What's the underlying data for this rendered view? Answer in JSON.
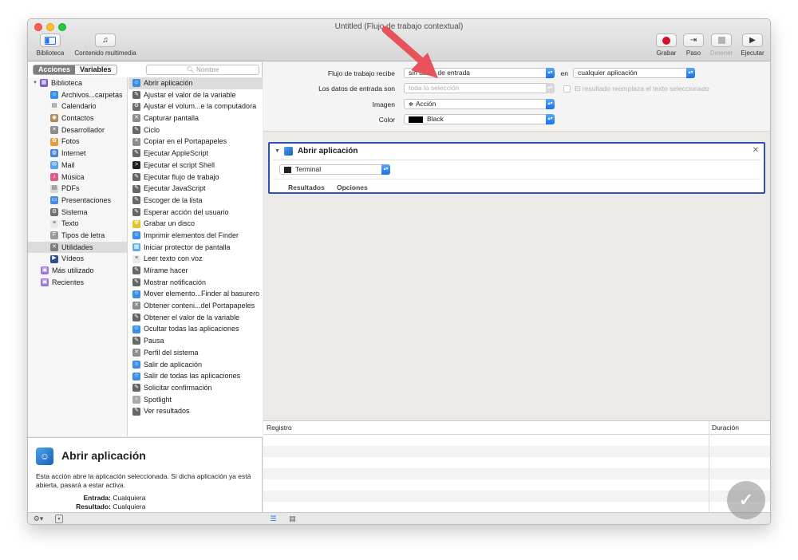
{
  "window": {
    "title": "Untitled (Flujo de trabajo contextual)"
  },
  "toolbar": {
    "left": [
      {
        "label": "Biblioteca",
        "icon": "library-icon"
      },
      {
        "label": "Contenido multimedia",
        "icon": "music-icon"
      }
    ],
    "right": [
      {
        "label": "Grabar",
        "icon": "record-icon",
        "enabled": true
      },
      {
        "label": "Paso",
        "icon": "step-icon",
        "enabled": true
      },
      {
        "label": "Detener",
        "icon": "stop-icon",
        "enabled": false
      },
      {
        "label": "Ejecutar",
        "icon": "play-icon",
        "enabled": true
      }
    ]
  },
  "sidebar": {
    "tabs": [
      "Acciones",
      "Variables"
    ],
    "active_tab": "Acciones",
    "search_placeholder": "Nombre",
    "library": [
      {
        "label": "Biblioteca",
        "level": 0,
        "icon": "library-icon"
      },
      {
        "label": "Archivos...carpetas",
        "level": 1,
        "icon": "finder-icon"
      },
      {
        "label": "Calendario",
        "level": 1,
        "icon": "calendar-icon"
      },
      {
        "label": "Contactos",
        "level": 1,
        "icon": "contacts-icon"
      },
      {
        "label": "Desarrollador",
        "level": 1,
        "icon": "tools-icon"
      },
      {
        "label": "Fotos",
        "level": 1,
        "icon": "photos-icon"
      },
      {
        "label": "Internet",
        "level": 1,
        "icon": "globe-icon"
      },
      {
        "label": "Mail",
        "level": 1,
        "icon": "mail-icon"
      },
      {
        "label": "Música",
        "level": 1,
        "icon": "music-icon"
      },
      {
        "label": "PDFs",
        "level": 1,
        "icon": "pdf-icon"
      },
      {
        "label": "Presentaciones",
        "level": 1,
        "icon": "presentation-icon"
      },
      {
        "label": "Sistema",
        "level": 1,
        "icon": "system-icon"
      },
      {
        "label": "Texto",
        "level": 1,
        "icon": "text-icon"
      },
      {
        "label": "Tipos de letra",
        "level": 1,
        "icon": "font-icon"
      },
      {
        "label": "Utilidades",
        "level": 1,
        "icon": "utilities-icon",
        "selected": true
      },
      {
        "label": "Vídeos",
        "level": 1,
        "icon": "video-icon"
      },
      {
        "label": "Más utilizado",
        "level": 0,
        "icon": "smart-folder-icon"
      },
      {
        "label": "Recientes",
        "level": 0,
        "icon": "smart-folder-icon"
      }
    ],
    "actions": [
      {
        "label": "Abrir aplicación",
        "icon": "finder-icon",
        "selected": true
      },
      {
        "label": "Ajustar el valor de la variable",
        "icon": "automator-icon"
      },
      {
        "label": "Ajustar el volum...e la computadora",
        "icon": "system-icon"
      },
      {
        "label": "Capturar pantalla",
        "icon": "tools-icon"
      },
      {
        "label": "Ciclo",
        "icon": "automator-icon"
      },
      {
        "label": "Copiar en el Portapapeles",
        "icon": "tools-icon"
      },
      {
        "label": "Ejecutar AppleScript",
        "icon": "automator-icon"
      },
      {
        "label": "Ejecutar el script Shell",
        "icon": "terminal-icon"
      },
      {
        "label": "Ejecutar flujo de trabajo",
        "icon": "automator-icon"
      },
      {
        "label": "Ejecutar JavaScript",
        "icon": "automator-icon"
      },
      {
        "label": "Escoger de la lista",
        "icon": "automator-icon"
      },
      {
        "label": "Esperar acción del usuario",
        "icon": "automator-icon"
      },
      {
        "label": "Grabar un disco",
        "icon": "burn-icon"
      },
      {
        "label": "Imprimir elementos del Finder",
        "icon": "finder-icon"
      },
      {
        "label": "Iniciar protector de pantalla",
        "icon": "screensaver-icon"
      },
      {
        "label": "Leer texto con voz",
        "icon": "text-icon"
      },
      {
        "label": "Mírame hacer",
        "icon": "automator-icon"
      },
      {
        "label": "Mostrar notificación",
        "icon": "automator-icon"
      },
      {
        "label": "Mover elemento...Finder al basurero",
        "icon": "finder-icon"
      },
      {
        "label": "Obtener conteni...del Portapapeles",
        "icon": "tools-icon"
      },
      {
        "label": "Obtener el valor de la variable",
        "icon": "automator-icon"
      },
      {
        "label": "Ocultar todas las aplicaciones",
        "icon": "finder-icon"
      },
      {
        "label": "Pausa",
        "icon": "automator-icon"
      },
      {
        "label": "Perfil del sistema",
        "icon": "tools-icon"
      },
      {
        "label": "Salir de aplicación",
        "icon": "finder-icon"
      },
      {
        "label": "Salir de todas las aplicaciones",
        "icon": "finder-icon"
      },
      {
        "label": "Solicitar confirmación",
        "icon": "automator-icon"
      },
      {
        "label": "Spotlight",
        "icon": "spotlight-icon"
      },
      {
        "label": "Ver resultados",
        "icon": "automator-icon"
      }
    ]
  },
  "description": {
    "title": "Abrir aplicación",
    "text": "Esta acción abre la aplicación seleccionada. Si dicha aplicación ya está abierta, pasará a estar activa.",
    "input_label": "Entrada:",
    "input_value": "Cualquiera",
    "result_label": "Resultado:",
    "result_value": "Cualquiera"
  },
  "properties": {
    "receives_label": "Flujo de trabajo recibe",
    "receives_value": "sin datos de entrada",
    "in_label": "en",
    "in_value": "cualquier aplicación",
    "input_is_label": "Los datos de entrada son",
    "input_is_value": "toda la selección",
    "replace_checkbox": "El resultado reemplaza el texto seleccionado",
    "image_label": "Imagen",
    "image_value": "Acción",
    "color_label": "Color",
    "color_value": "Black"
  },
  "action_card": {
    "title": "Abrir aplicación",
    "app_value": "Terminal",
    "tabs": [
      "Resultados",
      "Opciones"
    ]
  },
  "log": {
    "col_log": "Registro",
    "col_duration": "Duración"
  },
  "colors": {
    "accent": "#2a53b3",
    "arrow": "#e8535b",
    "record": "#d0112b"
  }
}
